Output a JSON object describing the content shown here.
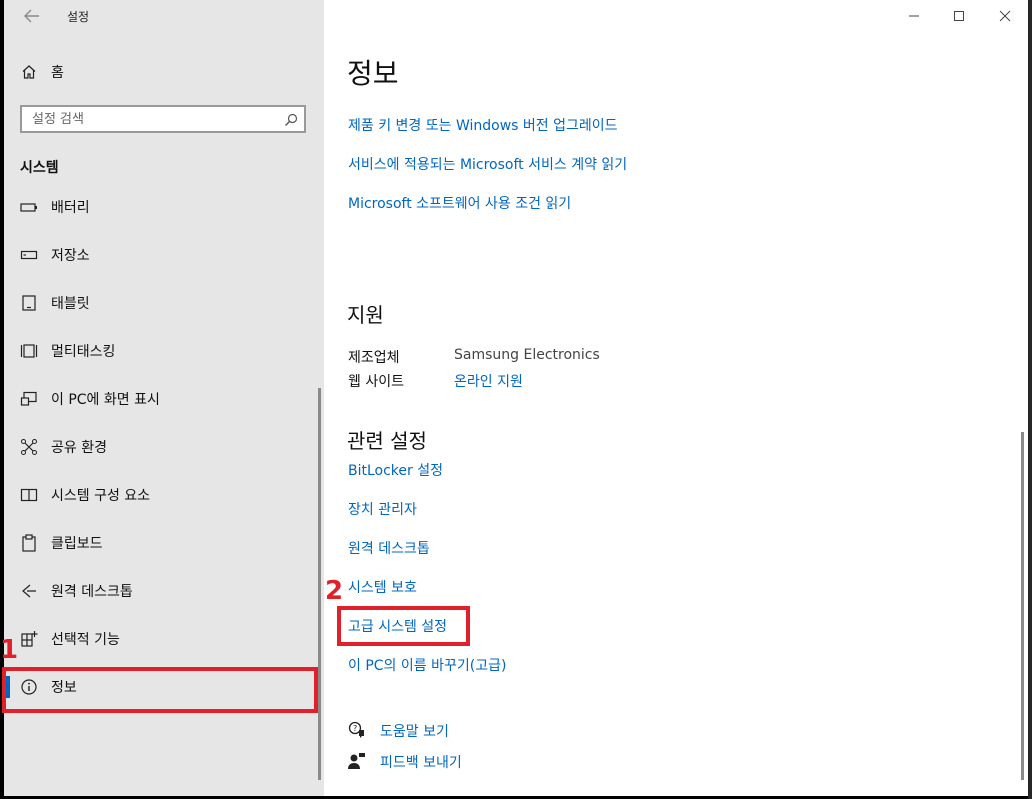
{
  "window": {
    "title": "설정"
  },
  "sidebar": {
    "home_label": "홈",
    "search_placeholder": "설정 검색",
    "section_title": "시스템",
    "items": [
      {
        "label": "배터리",
        "icon": "battery-icon"
      },
      {
        "label": "저장소",
        "icon": "storage-icon"
      },
      {
        "label": "태블릿",
        "icon": "tablet-icon"
      },
      {
        "label": "멀티태스킹",
        "icon": "multitasking-icon"
      },
      {
        "label": "이 PC에 화면 표시",
        "icon": "project-icon"
      },
      {
        "label": "공유 환경",
        "icon": "shared-experiences-icon"
      },
      {
        "label": "시스템 구성 요소",
        "icon": "components-icon"
      },
      {
        "label": "클립보드",
        "icon": "clipboard-icon"
      },
      {
        "label": "원격 데스크톱",
        "icon": "remote-desktop-icon"
      },
      {
        "label": "선택적 기능",
        "icon": "optional-features-icon"
      },
      {
        "label": "정보",
        "icon": "info-icon",
        "selected": true
      }
    ]
  },
  "content": {
    "title": "정보",
    "links": [
      "제품 키 변경 또는 Windows 버전 업그레이드",
      "서비스에 적용되는 Microsoft 서비스 계약 읽기",
      "Microsoft 소프트웨어 사용 조건 읽기"
    ],
    "support": {
      "title": "지원",
      "manufacturer_label": "제조업체",
      "manufacturer_value": "Samsung Electronics",
      "website_label": "웹 사이트",
      "website_link": "온라인 지원"
    },
    "related": {
      "title": "관련 설정",
      "links": [
        "BitLocker 설정",
        "장치 관리자",
        "원격 데스크톱",
        "시스템 보호",
        "고급 시스템 설정",
        "이 PC의 이름 바꾸기(고급)"
      ]
    },
    "help": {
      "get_help": "도움말 보기",
      "feedback": "피드백 보내기"
    }
  },
  "annotations": {
    "step1": "1",
    "step2": "2",
    "color": "#e0202a"
  },
  "colors": {
    "accent": "#0067c0",
    "sidebar_bg": "#e6e6e6"
  }
}
